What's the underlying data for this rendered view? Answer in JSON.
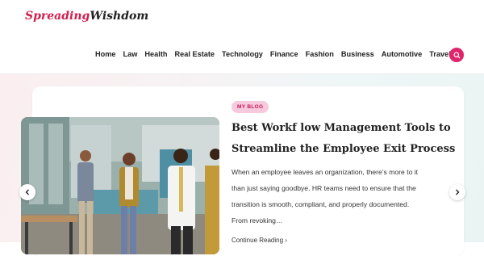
{
  "logo": {
    "part1": "Spreading",
    "part2": "Wishdom"
  },
  "nav": [
    {
      "label": "Home"
    },
    {
      "label": "Law"
    },
    {
      "label": "Health"
    },
    {
      "label": "Real Estate"
    },
    {
      "label": "Technology"
    },
    {
      "label": "Finance"
    },
    {
      "label": "Fashion"
    },
    {
      "label": "Business"
    },
    {
      "label": "Automotive"
    },
    {
      "label": "Travel"
    }
  ],
  "colors": {
    "accent": "#e0266b",
    "tag_bg": "#f7c9dc",
    "tag_text": "#c2185b"
  },
  "search_icon": "search-icon",
  "featured": {
    "tag": "MY BLOG",
    "title_line1": "Best Workf low Management Tools to",
    "title_line2": "Streamline the Employee Exit Process",
    "excerpt_lines": [
      "When an employee leaves an organization, there’s more to it",
      "than just saying goodbye. HR teams need to ensure that the",
      "transition is smooth, compliant, and properly documented.",
      "From revoking…"
    ],
    "continue": "Continue Reading"
  }
}
